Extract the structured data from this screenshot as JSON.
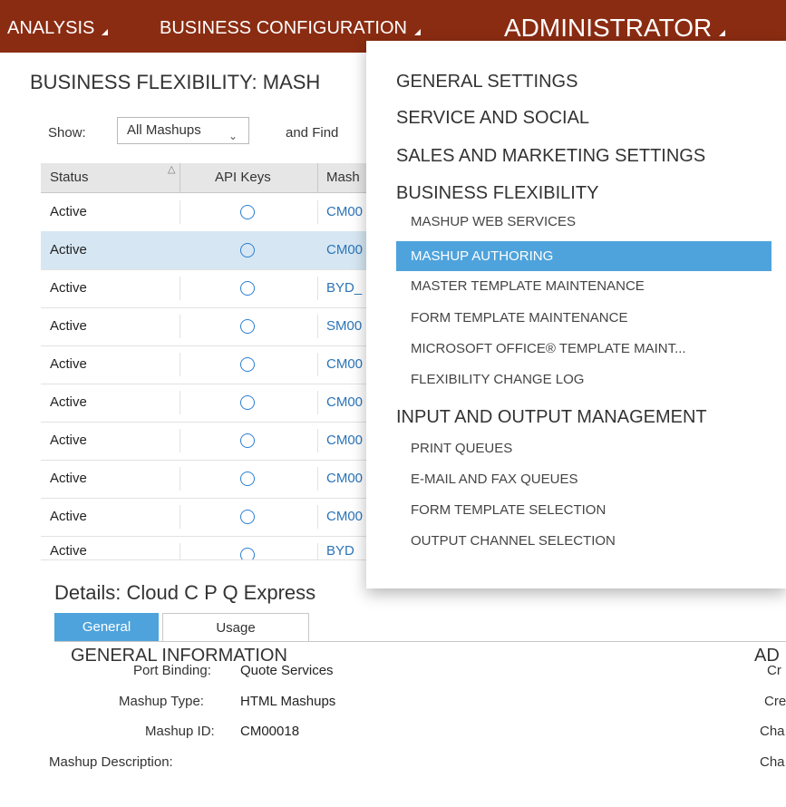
{
  "nav": {
    "items": [
      {
        "label": "ANALYSIS"
      },
      {
        "label": "BUSINESS CONFIGURATION"
      },
      {
        "label": "ADMINISTRATOR"
      }
    ]
  },
  "page": {
    "title": "BUSINESS FLEXIBILITY: MASH"
  },
  "filter": {
    "show_label": "Show:",
    "show_value": "All Mashups",
    "find_label": "and Find"
  },
  "table": {
    "headers": [
      "Status",
      "API Keys",
      "Mash"
    ],
    "rows": [
      {
        "status": "Active",
        "id": "CM00"
      },
      {
        "status": "Active",
        "id": "CM00"
      },
      {
        "status": "Active",
        "id": "BYD_"
      },
      {
        "status": "Active",
        "id": "SM00"
      },
      {
        "status": "Active",
        "id": "CM00"
      },
      {
        "status": "Active",
        "id": "CM00"
      },
      {
        "status": "Active",
        "id": "CM00"
      },
      {
        "status": "Active",
        "id": "CM00"
      },
      {
        "status": "Active",
        "id": "CM00"
      },
      {
        "status": "Active",
        "id": "BYD"
      }
    ],
    "selected_row": 1
  },
  "details": {
    "title": "Details: Cloud C P Q Express",
    "tabs": [
      {
        "label": "General"
      },
      {
        "label": "Usage"
      }
    ],
    "section_title": "GENERAL INFORMATION",
    "section_right": "AD",
    "fields": [
      {
        "label": "Port Binding:",
        "value": "Quote Services"
      },
      {
        "label": "Mashup Type:",
        "value": "HTML Mashups"
      },
      {
        "label": "Mashup ID:",
        "value": "CM00018"
      },
      {
        "label": "Mashup Description:",
        "value": ""
      }
    ],
    "right_labels": [
      "Cr",
      "Cre",
      "Cha",
      "Cha"
    ]
  },
  "dropdown": {
    "items": [
      {
        "label": "GENERAL SETTINGS",
        "kind": "category"
      },
      {
        "label": "SERVICE AND SOCIAL",
        "kind": "category"
      },
      {
        "label": "SALES AND MARKETING SETTINGS",
        "kind": "category"
      },
      {
        "label": "BUSINESS FLEXIBILITY",
        "kind": "category"
      },
      {
        "label": "MASHUP WEB SERVICES",
        "kind": "sub"
      },
      {
        "label": "MASHUP AUTHORING",
        "kind": "sub",
        "highlighted": true
      },
      {
        "label": "MASTER TEMPLATE MAINTENANCE",
        "kind": "sub"
      },
      {
        "label": "FORM TEMPLATE MAINTENANCE",
        "kind": "sub"
      },
      {
        "label": "MICROSOFT OFFICE® TEMPLATE MAINT...",
        "kind": "sub"
      },
      {
        "label": "FLEXIBILITY CHANGE LOG",
        "kind": "sub"
      },
      {
        "label": "INPUT AND OUTPUT MANAGEMENT",
        "kind": "category"
      },
      {
        "label": "PRINT QUEUES",
        "kind": "sub"
      },
      {
        "label": "E-MAIL AND FAX QUEUES",
        "kind": "sub"
      },
      {
        "label": "FORM TEMPLATE SELECTION",
        "kind": "sub"
      },
      {
        "label": "OUTPUT CHANNEL SELECTION",
        "kind": "sub"
      }
    ]
  },
  "colors": {
    "topbar": "#8a2c12",
    "accent": "#4ea3dc",
    "selected_row": "#d6e7f3",
    "link": "#2b74b8"
  }
}
